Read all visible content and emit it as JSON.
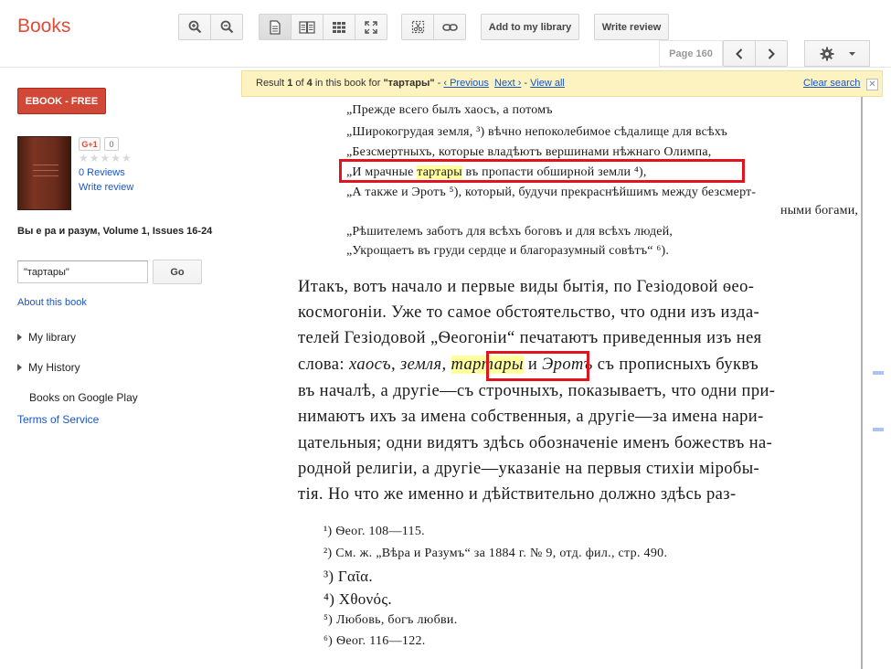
{
  "app": {
    "title": "Books"
  },
  "toolbar": {
    "add_library_label": "Add to my library",
    "write_review_label": "Write review",
    "page_label": "Page 160"
  },
  "sidebar": {
    "ebook_label": "EBOOK - FREE",
    "gplus_label": "G+1",
    "gplus_count": "0",
    "stars": "★★★★★",
    "reviews_label": "0 Reviews",
    "write_review_label": "Write review",
    "book_title": "Вы е ра и разум, Volume 1, Issues 16-24",
    "search_value": "\"тартары\"",
    "go_label": "Go",
    "about_label": "About this book",
    "my_library_label": "My library",
    "my_history_label": "My History",
    "google_play_label": "Books on Google Play",
    "terms_label": "Terms of Service"
  },
  "result_bar": {
    "prefix": "Result ",
    "current": "1",
    "of": " of ",
    "total": "4",
    "in_book": " in this book for ",
    "query": "\"тартары\"",
    "sep1": " - ",
    "previous_label": "‹ Previous",
    "next_label": "Next ›",
    "sep2": " - ",
    "view_all_label": "View all",
    "clear_label": "Clear search"
  },
  "scan": {
    "poem_lines": [
      "„Прежде всего былъ хаосъ, а потомъ",
      "„Широкогрудая земля, ³) вѣчно непоколебимое сѣдалище для всѣхъ",
      "„Безсмертныхъ, которые владѣютъ вершинами нѣжнаго Олимпа,",
      "„И мрачные ",
      "тартары",
      " въ пропасти обширной земли ⁴),",
      "„А также и Эротъ ⁵), который, будучи прекраснѣйшимъ между безсмерт-",
      "ными богами,",
      "„Рѣшителемъ заботъ для всѣхъ боговъ и для всѣхъ людей,",
      "„Укрощаетъ въ груди сердце и благоразумный совѣтъ“ ⁶)."
    ],
    "prose_lines": [
      "Итакъ, вотъ начало и первые виды бытія, по Гезіодовой ѳео-",
      "космогоніи. Уже то самое обстоятельство, что одни изъ изда-",
      "телей Гезіодовой „Ѳеогоніи“ печатаютъ приведенныя изъ нея",
      "слова: ",
      "хаосъ, земля, ",
      "тартары",
      " и ",
      "Эротъ",
      " съ прописныхъ буквъ",
      "въ началѣ, а другіе—съ строчныхъ, показываетъ, что одни при-",
      "нимаютъ ихъ за имена собственныя, а другіе—за имена нари-",
      "цательныя; одни видятъ здѣсь обозначеніе именъ божествъ на-",
      "родной религіи, а другіе—указаніе на первыя стихіи міробы-",
      "тія. Но что же именно и дѣйствительно должно здѣсь раз-"
    ],
    "footnotes": [
      "¹) Ѳеог. 108—115.",
      "²) См. ж. „Вѣра и Разумъ“ за 1884 г. № 9, отд. фил., стр. 490.",
      "³) Γαῖα.",
      "⁴) Χθονός.",
      "⁵) Любовь, богъ любви.",
      "⁶) Ѳеог. 116—122."
    ]
  },
  "colors": {
    "brand_red": "#dd4b39",
    "link_blue": "#1a55c4",
    "result_bar_bg": "#fdf3c0",
    "highlight": "#ffff9e",
    "match_box": "#e0141e"
  },
  "icons": [
    "zoom-in-icon",
    "zoom-out-icon",
    "single-page-icon",
    "two-page-icon",
    "thumbnails-icon",
    "fullscreen-icon",
    "clip-icon",
    "link-icon",
    "prev-page-icon",
    "next-page-icon",
    "gear-icon",
    "close-icon"
  ]
}
